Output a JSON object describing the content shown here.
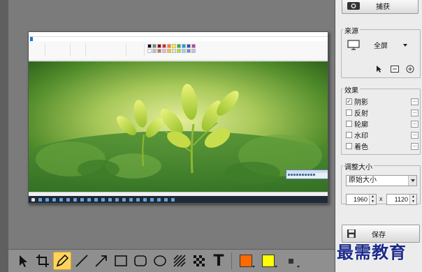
{
  "panel": {
    "capture_label": "捕获",
    "source": {
      "title": "来源",
      "value": "全屏"
    },
    "effects": {
      "title": "效果",
      "items": [
        {
          "label": "阴影",
          "checked": true
        },
        {
          "label": "反射",
          "checked": false
        },
        {
          "label": "轮廓",
          "checked": false
        },
        {
          "label": "水印",
          "checked": false
        },
        {
          "label": "着色",
          "checked": false
        }
      ]
    },
    "resize": {
      "title": "调整大小",
      "preset": "原始大小",
      "width": "1960",
      "times": "x",
      "height": "1120"
    },
    "save_label": "保存"
  },
  "toolbar": {
    "tools": [
      "select-tool",
      "crop-tool",
      "pen-tool",
      "line-tool",
      "arrow-tool",
      "rectangle-tool",
      "rounded-rectangle-tool",
      "ellipse-tool",
      "hatch-tool",
      "pixelate-tool",
      "text-tool"
    ],
    "active_tool": "pen-tool",
    "primary_color": "#ff6a00",
    "secondary_color": "#ffff00",
    "text_tool_label": "T"
  },
  "watermark": "最需教育",
  "colors": {
    "panel_bg": "#ececec",
    "canvas_bg": "#7b7b7b",
    "active_tool_bg": "#ffd35c",
    "watermark": "#1c2a8a"
  }
}
